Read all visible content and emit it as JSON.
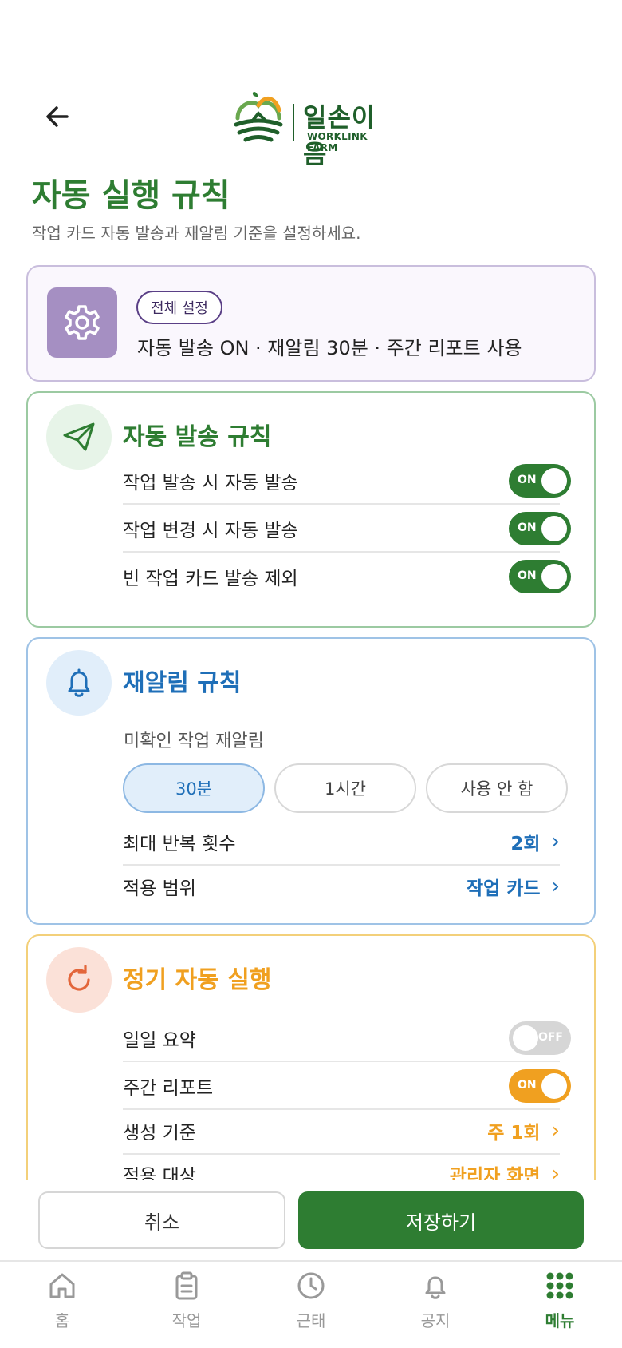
{
  "header": {
    "logo_text": "일손이음",
    "logo_sub": "WORKLINK FARM"
  },
  "page": {
    "title": "자동 실행 규칙",
    "subtitle": "작업 카드 자동 발송과 재알림 기준을 설정하세요."
  },
  "summary": {
    "badge": "전체 설정",
    "text": "자동 발송 ON · 재알림 30분 · 주간 리포트 사용"
  },
  "auto_send": {
    "title": "자동 발송 규칙",
    "rows": [
      {
        "label": "작업 발송 시 자동 발송",
        "toggle": "ON"
      },
      {
        "label": "작업 변경 시 자동 발송",
        "toggle": "ON"
      },
      {
        "label": "빈 작업 카드 발송 제외",
        "toggle": "ON"
      }
    ]
  },
  "remind": {
    "title": "재알림 규칙",
    "sub_label": "미확인 작업 재알림",
    "options": [
      "30분",
      "1시간",
      "사용 안 함"
    ],
    "selected": "30분",
    "rows": [
      {
        "label": "최대 반복 횟수",
        "value": "2회"
      },
      {
        "label": "적용 범위",
        "value": "작업 카드"
      }
    ]
  },
  "periodic": {
    "title": "정기 자동 실행",
    "rows": [
      {
        "label": "일일 요약",
        "toggle": "OFF"
      },
      {
        "label": "주간 리포트",
        "toggle": "ON"
      },
      {
        "label": "생성 기준",
        "value": "주 1회"
      },
      {
        "label": "적용 대상",
        "value": "관리자 화면"
      }
    ]
  },
  "actions": {
    "cancel": "취소",
    "save": "저장하기"
  },
  "nav": [
    {
      "label": "홈",
      "icon": "home-icon"
    },
    {
      "label": "작업",
      "icon": "clipboard-icon"
    },
    {
      "label": "근태",
      "icon": "clock-icon"
    },
    {
      "label": "공지",
      "icon": "bell-icon"
    },
    {
      "label": "메뉴",
      "icon": "grid-icon",
      "active": true
    }
  ],
  "colors": {
    "primary_green": "#2e7d32",
    "remind_blue": "#1f6fb8",
    "periodic_orange": "#f0a020",
    "summary_purple": "#a58fc2"
  }
}
